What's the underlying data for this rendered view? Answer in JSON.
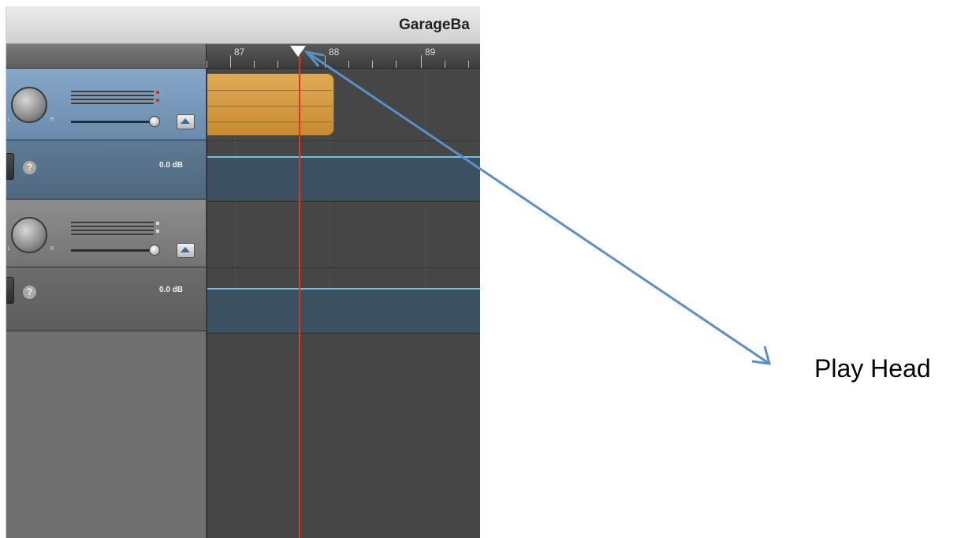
{
  "window": {
    "title": "GarageBa"
  },
  "ruler": {
    "labels": [
      "87",
      "88",
      "89"
    ]
  },
  "tracks": [
    {
      "volume_label": "0.0 dB",
      "selected": true,
      "help_glyph": "?"
    },
    {
      "volume_label": "0.0 dB",
      "selected": false,
      "help_glyph": "?"
    }
  ],
  "pan_knob": {
    "left_label": "L",
    "right_label": "R"
  },
  "annotation": {
    "text": "Play Head"
  },
  "colors": {
    "playhead": "#e0371f",
    "region": "#d89c45",
    "automation_line": "#73c2e8",
    "selected_track": "#7898b9",
    "annotation_arrow": "#5b8fc8"
  },
  "icons": [
    "pan-knob-icon",
    "help-icon",
    "expand-triangle-icon",
    "playhead-marker-icon",
    "arrow-icon"
  ]
}
